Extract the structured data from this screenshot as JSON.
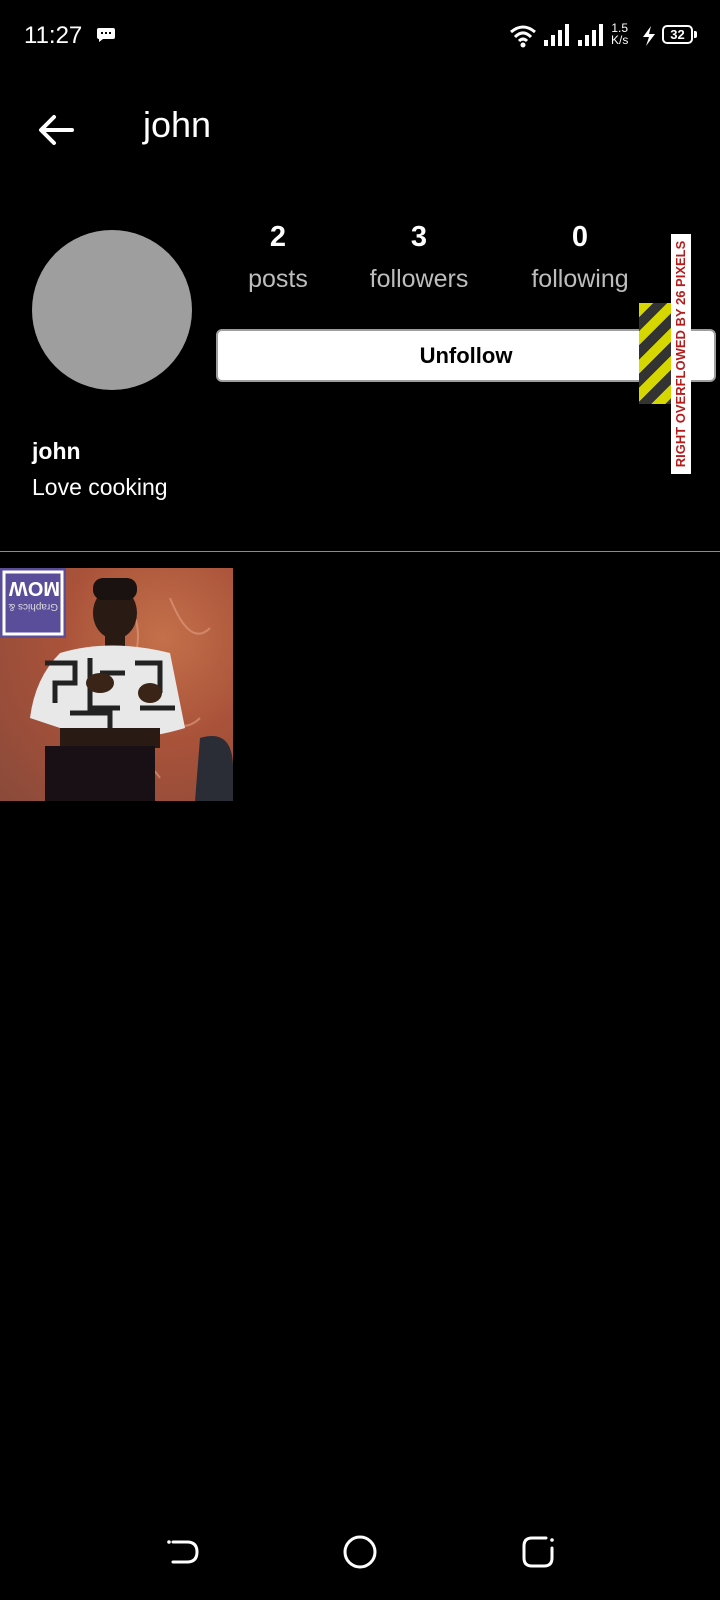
{
  "status_bar": {
    "time": "11:27",
    "net_speed_value": "1.5",
    "net_speed_unit": "K/s",
    "battery_level": "32"
  },
  "app_bar": {
    "title": "john"
  },
  "profile": {
    "stats": [
      {
        "value": "2",
        "label": "posts"
      },
      {
        "value": "3",
        "label": "followers"
      },
      {
        "value": "0",
        "label": "following"
      }
    ],
    "unfollow_label": "Unfollow",
    "name": "john",
    "bio": "Love cooking"
  },
  "debug_overlay": {
    "text": "RIGHT OVERFLOWED BY 26 PIXELS"
  },
  "posts": {
    "count": 1,
    "thumbnail_text": [
      "MOW",
      "Graphics &"
    ]
  },
  "colors": {
    "background": "#000000",
    "avatar": "#9e9e9e",
    "button_bg": "#ffffff",
    "overflow_text": "#b71c1c",
    "overflow_stripe_yellow": "#d7d700"
  }
}
